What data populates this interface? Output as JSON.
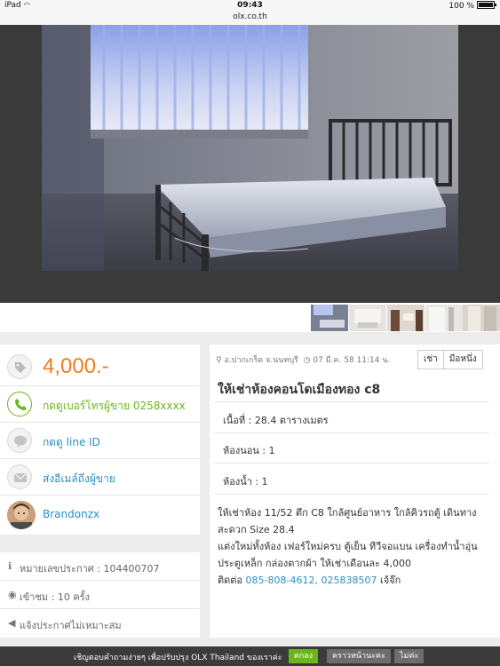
{
  "status_bar": {
    "device": "iPad",
    "time": "09:43",
    "battery": "100 %"
  },
  "browser": {
    "url": "olx.co.th"
  },
  "listing": {
    "price": "4,000.-",
    "call_link": "กดดูเบอร์โทรผู้ขาย 0258xxxx",
    "line_link": "กดดู line ID",
    "email_link": "ส่งอีเมล์ถึงผู้ขาย",
    "seller_name": "Brandonzx",
    "location": "อ.ปากเกร็ด จ.นนทบุรี",
    "date": "07 มี.ค. 58 11:14 น.",
    "type_buttons": [
      "เช่า",
      "มือหนึ่ง"
    ],
    "title": "ให้เช่าห้องคอนโดเมืองทอง c8",
    "specs": [
      "เนื้อที่ : 28.4 ตารางเมตร",
      "ห้องนอน : 1",
      "ห้องน้ำ : 1"
    ],
    "description_lines": [
      "ให้เช่าห้อง 11/52 ตึก C8 ใกล้ศูนย์อาหาร ใกล้คิวรถตู้ เดินทาง",
      "สะดวก Size 28.4",
      "แต่งใหม่ทั้งห้อง เฟอร์ใหม่ครบ ตู้เย็น ทีวีจอแบน เครื่องทำน้ำอุ่น",
      "ประตูเหล็ก กล่องตากผ้า ให้เช่าเดือนละ 4,000"
    ],
    "contact_prefix": "ติดต่อ",
    "contact_phones": "085-808-4612, 025838507",
    "contact_suffix": "เจ้จ๊ก"
  },
  "meta": {
    "ad_number": "หมายเลขประกาศ : 104400707",
    "views": "เข้าชม : 10 ครั้ง",
    "report": "แจ้งประกาศไม่เหมาะสม"
  },
  "survey_banner": {
    "message": "เชิญตอบคำถามง่ายๆ เพื่อปรับปรุง OLX Thailand ของเราค่ะ",
    "accept": "ตกลง",
    "later": "คราวหน้านะคะ",
    "decline": "ไม่ค่ะ"
  },
  "colors": {
    "price": "#f07d1a",
    "green_link": "#6ab61b",
    "blue_link": "#2a8fc0",
    "banner_accept": "#6ab61b"
  },
  "icons": [
    "tag-icon",
    "phone-icon",
    "line-icon",
    "envelope-icon",
    "info-icon",
    "eye-icon",
    "megaphone-icon",
    "map-pin-icon",
    "clock-icon"
  ]
}
